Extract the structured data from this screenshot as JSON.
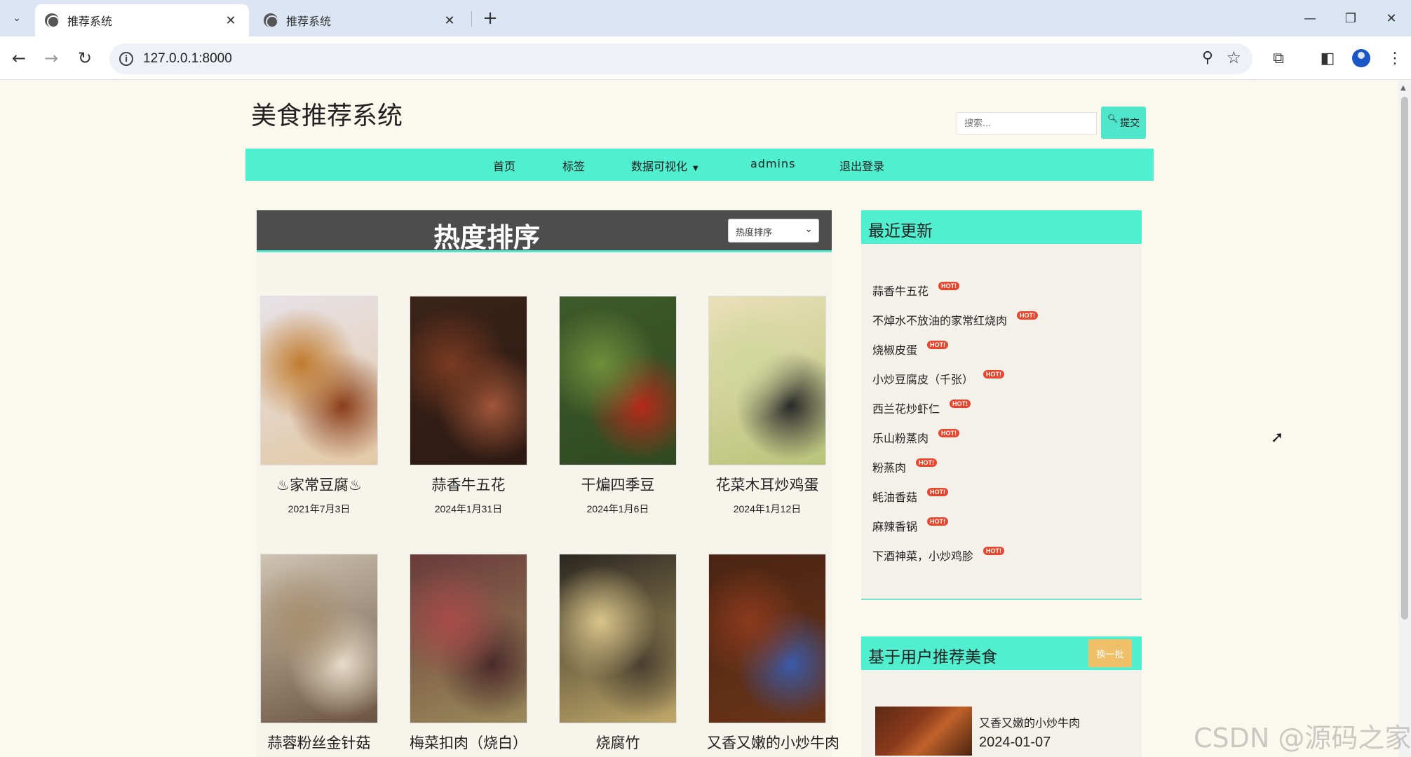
{
  "browser": {
    "tabs": [
      {
        "title": "推荐系统",
        "active": true
      },
      {
        "title": "推荐系统",
        "active": false
      }
    ],
    "url": "127.0.0.1:8000"
  },
  "site": {
    "title": "美食推荐系统",
    "search_placeholder": "搜索...",
    "search_button": "提交"
  },
  "nav": {
    "items": [
      "首页",
      "标签",
      "数据可视化",
      "admins",
      "退出登录"
    ]
  },
  "main": {
    "title": "热度排序",
    "sort_selected": "热度排序",
    "foods": [
      {
        "name": "♨家常豆腐♨",
        "date": "2021年7月3日",
        "colors": [
          "#e7e2e8",
          "#c07a2c",
          "#8a3d18",
          "#e3c9a6"
        ]
      },
      {
        "name": "蒜香牛五花",
        "date": "2024年1月31日",
        "colors": [
          "#3a2318",
          "#7a3a22",
          "#a0563a",
          "#2d1a12"
        ]
      },
      {
        "name": "干煸四季豆",
        "date": "2024年1月6日",
        "colors": [
          "#3d5a2a",
          "#6f8f3c",
          "#b52a1a",
          "#2f4a22"
        ]
      },
      {
        "name": "花菜木耳炒鸡蛋",
        "date": "2024年1月12日",
        "colors": [
          "#e9e0b8",
          "#cfd89b",
          "#2a2a2a",
          "#b8c47a"
        ]
      },
      {
        "name": "蒜蓉粉丝金针菇",
        "date": "",
        "colors": [
          "#cfc3b2",
          "#a78e6e",
          "#e8dcc8",
          "#6b5440"
        ]
      },
      {
        "name": "梅菜扣肉（烧白）",
        "date": "",
        "colors": [
          "#6a3a3a",
          "#a84a4a",
          "#4a2a2a",
          "#9a8a5a"
        ]
      },
      {
        "name": "烧腐竹",
        "date": "",
        "colors": [
          "#2a2620",
          "#d9c48a",
          "#4a4030",
          "#c0a86a"
        ]
      },
      {
        "name": "又香又嫩的小炒牛肉",
        "date": "",
        "colors": [
          "#4a2414",
          "#8b3a1c",
          "#3a5aa8",
          "#6a3418"
        ]
      }
    ]
  },
  "recent": {
    "title": "最近更新",
    "hot_label": "HOT!",
    "items": [
      "蒜香牛五花",
      "不焯水不放油的家常红烧肉",
      "烧椒皮蛋",
      "小炒豆腐皮（千张）",
      "西兰花炒虾仁",
      "乐山粉蒸肉",
      "粉蒸肉",
      "蚝油香菇",
      "麻辣香锅",
      "下酒神菜，小炒鸡胗"
    ]
  },
  "recommend": {
    "title": "基于用户推荐美食",
    "refresh_button": "换一批",
    "item_name": "又香又嫩的小炒牛肉",
    "item_date": "2024-01-07"
  },
  "watermark": "CSDN @源码之家"
}
